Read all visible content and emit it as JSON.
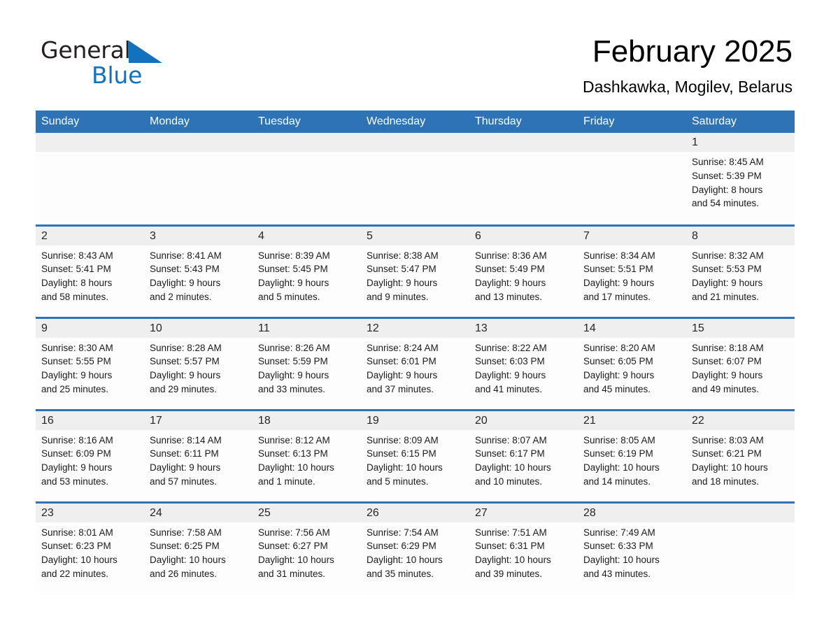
{
  "brand": {
    "name_part1": "General",
    "name_part2": "Blue",
    "triangle_color": "#1272bd",
    "logo_icon": "general-blue-triangle-logo"
  },
  "header": {
    "title": "February 2025",
    "subtitle": "Dashkawka, Mogilev, Belarus"
  },
  "colors": {
    "header_blue": "#2e73b5",
    "row_border_blue": "#2e73b5",
    "daynum_strip": "#efefef",
    "brand_blue": "#1272bd",
    "text": "#1a1a1a"
  },
  "weekday_headers": [
    "Sunday",
    "Monday",
    "Tuesday",
    "Wednesday",
    "Thursday",
    "Friday",
    "Saturday"
  ],
  "weeks": [
    [
      {
        "day": "",
        "sunrise": "",
        "sunset": "",
        "daylight_line1": "",
        "daylight_line2": ""
      },
      {
        "day": "",
        "sunrise": "",
        "sunset": "",
        "daylight_line1": "",
        "daylight_line2": ""
      },
      {
        "day": "",
        "sunrise": "",
        "sunset": "",
        "daylight_line1": "",
        "daylight_line2": ""
      },
      {
        "day": "",
        "sunrise": "",
        "sunset": "",
        "daylight_line1": "",
        "daylight_line2": ""
      },
      {
        "day": "",
        "sunrise": "",
        "sunset": "",
        "daylight_line1": "",
        "daylight_line2": ""
      },
      {
        "day": "",
        "sunrise": "",
        "sunset": "",
        "daylight_line1": "",
        "daylight_line2": ""
      },
      {
        "day": "1",
        "sunrise": "Sunrise: 8:45 AM",
        "sunset": "Sunset: 5:39 PM",
        "daylight_line1": "Daylight: 8 hours",
        "daylight_line2": "and 54 minutes."
      }
    ],
    [
      {
        "day": "2",
        "sunrise": "Sunrise: 8:43 AM",
        "sunset": "Sunset: 5:41 PM",
        "daylight_line1": "Daylight: 8 hours",
        "daylight_line2": "and 58 minutes."
      },
      {
        "day": "3",
        "sunrise": "Sunrise: 8:41 AM",
        "sunset": "Sunset: 5:43 PM",
        "daylight_line1": "Daylight: 9 hours",
        "daylight_line2": "and 2 minutes."
      },
      {
        "day": "4",
        "sunrise": "Sunrise: 8:39 AM",
        "sunset": "Sunset: 5:45 PM",
        "daylight_line1": "Daylight: 9 hours",
        "daylight_line2": "and 5 minutes."
      },
      {
        "day": "5",
        "sunrise": "Sunrise: 8:38 AM",
        "sunset": "Sunset: 5:47 PM",
        "daylight_line1": "Daylight: 9 hours",
        "daylight_line2": "and 9 minutes."
      },
      {
        "day": "6",
        "sunrise": "Sunrise: 8:36 AM",
        "sunset": "Sunset: 5:49 PM",
        "daylight_line1": "Daylight: 9 hours",
        "daylight_line2": "and 13 minutes."
      },
      {
        "day": "7",
        "sunrise": "Sunrise: 8:34 AM",
        "sunset": "Sunset: 5:51 PM",
        "daylight_line1": "Daylight: 9 hours",
        "daylight_line2": "and 17 minutes."
      },
      {
        "day": "8",
        "sunrise": "Sunrise: 8:32 AM",
        "sunset": "Sunset: 5:53 PM",
        "daylight_line1": "Daylight: 9 hours",
        "daylight_line2": "and 21 minutes."
      }
    ],
    [
      {
        "day": "9",
        "sunrise": "Sunrise: 8:30 AM",
        "sunset": "Sunset: 5:55 PM",
        "daylight_line1": "Daylight: 9 hours",
        "daylight_line2": "and 25 minutes."
      },
      {
        "day": "10",
        "sunrise": "Sunrise: 8:28 AM",
        "sunset": "Sunset: 5:57 PM",
        "daylight_line1": "Daylight: 9 hours",
        "daylight_line2": "and 29 minutes."
      },
      {
        "day": "11",
        "sunrise": "Sunrise: 8:26 AM",
        "sunset": "Sunset: 5:59 PM",
        "daylight_line1": "Daylight: 9 hours",
        "daylight_line2": "and 33 minutes."
      },
      {
        "day": "12",
        "sunrise": "Sunrise: 8:24 AM",
        "sunset": "Sunset: 6:01 PM",
        "daylight_line1": "Daylight: 9 hours",
        "daylight_line2": "and 37 minutes."
      },
      {
        "day": "13",
        "sunrise": "Sunrise: 8:22 AM",
        "sunset": "Sunset: 6:03 PM",
        "daylight_line1": "Daylight: 9 hours",
        "daylight_line2": "and 41 minutes."
      },
      {
        "day": "14",
        "sunrise": "Sunrise: 8:20 AM",
        "sunset": "Sunset: 6:05 PM",
        "daylight_line1": "Daylight: 9 hours",
        "daylight_line2": "and 45 minutes."
      },
      {
        "day": "15",
        "sunrise": "Sunrise: 8:18 AM",
        "sunset": "Sunset: 6:07 PM",
        "daylight_line1": "Daylight: 9 hours",
        "daylight_line2": "and 49 minutes."
      }
    ],
    [
      {
        "day": "16",
        "sunrise": "Sunrise: 8:16 AM",
        "sunset": "Sunset: 6:09 PM",
        "daylight_line1": "Daylight: 9 hours",
        "daylight_line2": "and 53 minutes."
      },
      {
        "day": "17",
        "sunrise": "Sunrise: 8:14 AM",
        "sunset": "Sunset: 6:11 PM",
        "daylight_line1": "Daylight: 9 hours",
        "daylight_line2": "and 57 minutes."
      },
      {
        "day": "18",
        "sunrise": "Sunrise: 8:12 AM",
        "sunset": "Sunset: 6:13 PM",
        "daylight_line1": "Daylight: 10 hours",
        "daylight_line2": "and 1 minute."
      },
      {
        "day": "19",
        "sunrise": "Sunrise: 8:09 AM",
        "sunset": "Sunset: 6:15 PM",
        "daylight_line1": "Daylight: 10 hours",
        "daylight_line2": "and 5 minutes."
      },
      {
        "day": "20",
        "sunrise": "Sunrise: 8:07 AM",
        "sunset": "Sunset: 6:17 PM",
        "daylight_line1": "Daylight: 10 hours",
        "daylight_line2": "and 10 minutes."
      },
      {
        "day": "21",
        "sunrise": "Sunrise: 8:05 AM",
        "sunset": "Sunset: 6:19 PM",
        "daylight_line1": "Daylight: 10 hours",
        "daylight_line2": "and 14 minutes."
      },
      {
        "day": "22",
        "sunrise": "Sunrise: 8:03 AM",
        "sunset": "Sunset: 6:21 PM",
        "daylight_line1": "Daylight: 10 hours",
        "daylight_line2": "and 18 minutes."
      }
    ],
    [
      {
        "day": "23",
        "sunrise": "Sunrise: 8:01 AM",
        "sunset": "Sunset: 6:23 PM",
        "daylight_line1": "Daylight: 10 hours",
        "daylight_line2": "and 22 minutes."
      },
      {
        "day": "24",
        "sunrise": "Sunrise: 7:58 AM",
        "sunset": "Sunset: 6:25 PM",
        "daylight_line1": "Daylight: 10 hours",
        "daylight_line2": "and 26 minutes."
      },
      {
        "day": "25",
        "sunrise": "Sunrise: 7:56 AM",
        "sunset": "Sunset: 6:27 PM",
        "daylight_line1": "Daylight: 10 hours",
        "daylight_line2": "and 31 minutes."
      },
      {
        "day": "26",
        "sunrise": "Sunrise: 7:54 AM",
        "sunset": "Sunset: 6:29 PM",
        "daylight_line1": "Daylight: 10 hours",
        "daylight_line2": "and 35 minutes."
      },
      {
        "day": "27",
        "sunrise": "Sunrise: 7:51 AM",
        "sunset": "Sunset: 6:31 PM",
        "daylight_line1": "Daylight: 10 hours",
        "daylight_line2": "and 39 minutes."
      },
      {
        "day": "28",
        "sunrise": "Sunrise: 7:49 AM",
        "sunset": "Sunset: 6:33 PM",
        "daylight_line1": "Daylight: 10 hours",
        "daylight_line2": "and 43 minutes."
      },
      {
        "day": "",
        "sunrise": "",
        "sunset": "",
        "daylight_line1": "",
        "daylight_line2": ""
      }
    ]
  ]
}
